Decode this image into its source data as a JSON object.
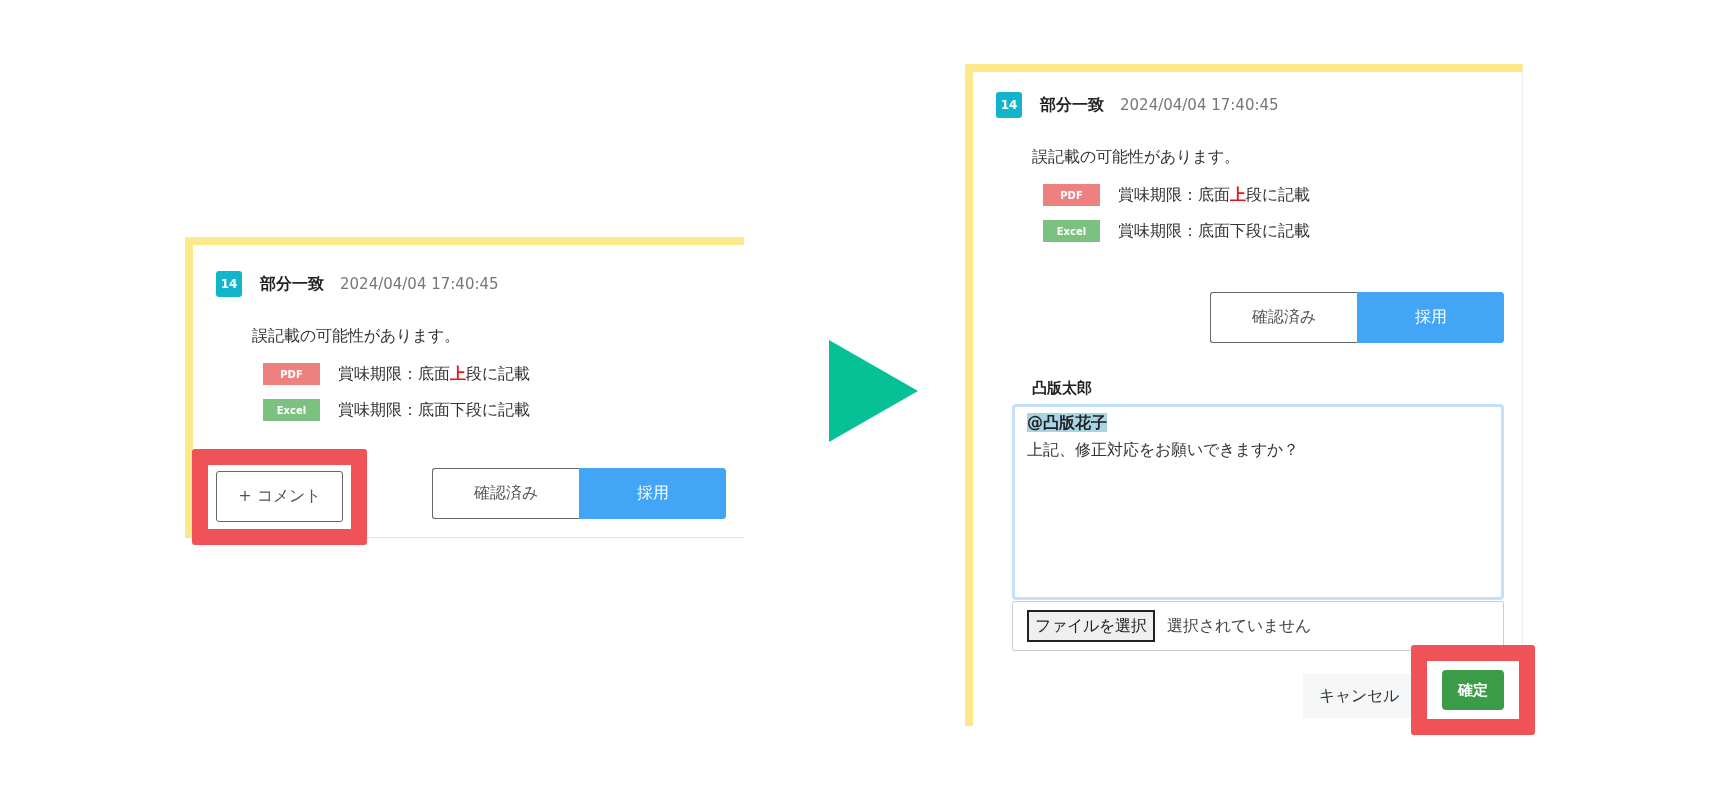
{
  "panels": [
    {
      "kind": "before",
      "number": "14",
      "match": "部分一致",
      "timestamp": "2024/04/04 17:40:45",
      "message": "誤記載の可能性があります。",
      "sources": [
        {
          "label": "PDF",
          "color": "#ef8080",
          "segments": [
            {
              "text": "賞味期限：底面",
              "emphasis": false
            },
            {
              "text": "上",
              "emphasis": true
            },
            {
              "text": "段に記載",
              "emphasis": false
            }
          ]
        },
        {
          "label": "Excel",
          "color": "#7cc17f",
          "segments": [
            {
              "text": "賞味期限：底面下段に記載",
              "emphasis": false
            }
          ]
        }
      ],
      "comment_button": {
        "label": "+ コメント",
        "highlighted": true
      },
      "decision": [
        {
          "label": "確認済み",
          "selected": false
        },
        {
          "label": "採用",
          "selected": true
        }
      ]
    },
    {
      "kind": "after",
      "number": "14",
      "match": "部分一致",
      "timestamp": "2024/04/04 17:40:45",
      "message": "誤記載の可能性があります。",
      "sources": [
        {
          "label": "PDF",
          "color": "#ef8080",
          "segments": [
            {
              "text": "賞味期限：底面",
              "emphasis": false
            },
            {
              "text": "上",
              "emphasis": true
            },
            {
              "text": "段に記載",
              "emphasis": false
            }
          ]
        },
        {
          "label": "Excel",
          "color": "#7cc17f",
          "segments": [
            {
              "text": "賞味期限：底面下段に記載",
              "emphasis": false
            }
          ]
        }
      ],
      "decision": [
        {
          "label": "確認済み",
          "selected": false
        },
        {
          "label": "採用",
          "selected": true
        }
      ],
      "comment_form": {
        "author": "凸版太郎",
        "mention": "@凸版花子",
        "body": "上記、修正対応をお願いできますか？",
        "file_button": "ファイルを選択",
        "file_status": "選択されていません",
        "cancel": "キャンセル",
        "confirm": {
          "label": "確定",
          "highlighted": true
        }
      }
    }
  ]
}
